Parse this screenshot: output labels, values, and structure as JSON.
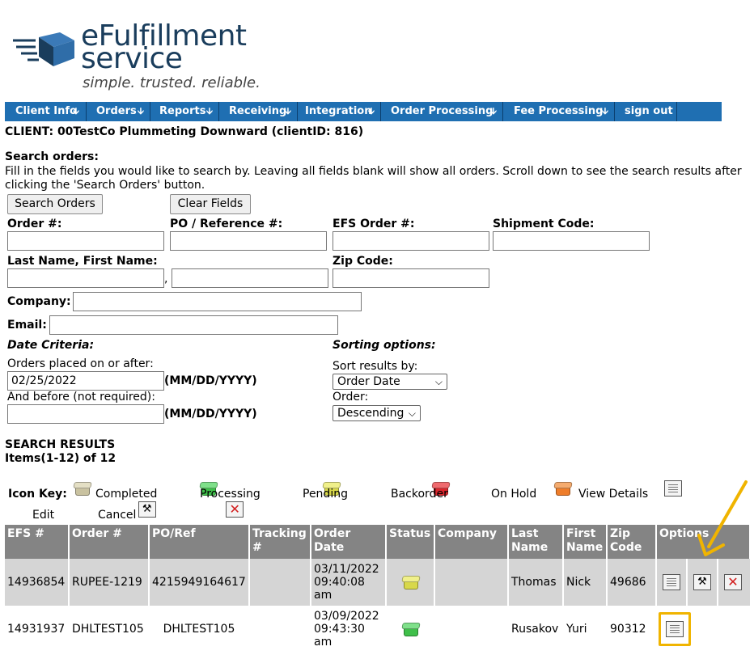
{
  "logo": {
    "line1": "eFulfillment",
    "line2": "service",
    "tagline": "simple. trusted. reliable."
  },
  "nav": {
    "items": [
      {
        "label": "Client Info",
        "arrow": true
      },
      {
        "label": "Orders",
        "arrow": true
      },
      {
        "label": "Reports",
        "arrow": true
      },
      {
        "label": "Receiving",
        "arrow": true
      },
      {
        "label": "Integration",
        "arrow": true
      },
      {
        "label": "Order Processing",
        "arrow": true
      },
      {
        "label": "Fee Processing",
        "arrow": true
      },
      {
        "label": "sign out",
        "arrow": false
      }
    ]
  },
  "client_line": "CLIENT: 00TestCo Plummeting Downward (clientID: 816)",
  "search": {
    "heading": "Search orders:",
    "instructions": "Fill in the fields you would like to search by. Leaving all fields blank will show all orders. Scroll down to see the search results after clicking the 'Search Orders' button.",
    "search_button": "Search Orders",
    "clear_button": "Clear Fields",
    "labels": {
      "order_no": "Order #:",
      "po_ref": "PO / Reference #:",
      "efs_order": "EFS Order #:",
      "shipment_code": "Shipment Code:",
      "name": "Last Name, First Name:",
      "zip": "Zip Code:",
      "company": "Company:",
      "email": "Email:"
    },
    "name_separator": ",",
    "date_criteria": "Date Criteria:",
    "placed_on_after": "Orders placed on or after:",
    "placed_value": "02/25/2022",
    "date_format": "(MM/DD/YYYY)",
    "and_before": "And before (not required):",
    "sorting_options": "Sorting options:",
    "sort_by_label": "Sort results by:",
    "sort_by_value": "Order Date",
    "order_label": "Order:",
    "order_value": "Descending"
  },
  "results": {
    "heading": "SEARCH RESULTS",
    "items_count": "Items(1-12) of 12",
    "icon_key_label": "Icon Key:",
    "icon_key": [
      {
        "label": "Completed",
        "icon": "box-completed-icon",
        "color": "#c9c2a0"
      },
      {
        "label": "Processing",
        "icon": "box-processing-icon",
        "color": "#3fbf4a"
      },
      {
        "label": "Pending",
        "icon": "box-pending-icon",
        "color": "#d8d84a"
      },
      {
        "label": "Backorder",
        "icon": "box-backorder-icon",
        "color": "#d9262c"
      },
      {
        "label": "On Hold",
        "icon": "box-on-hold-icon",
        "color": "#ee7d2a"
      },
      {
        "label": "View Details",
        "icon": "view-details-icon"
      },
      {
        "label": "Edit",
        "icon": "edit-icon"
      },
      {
        "label": "Cancel",
        "icon": "cancel-icon"
      }
    ],
    "columns": [
      "EFS #",
      "Order #",
      "PO/Ref",
      "Tracking #",
      "Order Date",
      "Status",
      "Company",
      "Last Name",
      "First Name",
      "Zip Code",
      "Options"
    ],
    "rows": [
      {
        "efs": "14936854",
        "order": "RUPEE-1219",
        "po": "4215949164617",
        "tracking": "",
        "date": "03/11/2022",
        "time": "09:40:08",
        "ampm": "am",
        "status": "Pending",
        "company": "",
        "last": "Thomas",
        "first": "Nick",
        "zip": "49686"
      },
      {
        "efs": "14931937",
        "order": "DHLTEST105",
        "po": "DHLTEST105",
        "tracking": "",
        "date": "03/09/2022",
        "time": "09:43:30",
        "ampm": "am",
        "status": "Processing",
        "company": "",
        "last": "Rusakov",
        "first": "Yuri",
        "zip": "90312"
      }
    ]
  },
  "colors": {
    "nav_bg": "#1f6fb2",
    "table_header": "#848484",
    "row_alt": "#d5d5d5",
    "highlight": "#f0b400",
    "logo_blue": "#1a3d5c"
  }
}
